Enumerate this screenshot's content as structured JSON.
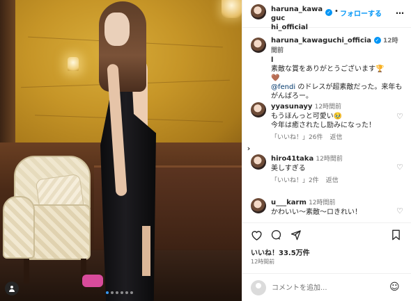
{
  "post": {
    "username": "haruna_kawaguchi_official",
    "username_line1": "haruna_kawaguc",
    "username_line2": "hi_official",
    "separator": "•",
    "follow_label": "フォローする",
    "more": "…",
    "caption": {
      "username_line1": "haruna_kawaguchi_officia",
      "username_line2": "l",
      "time": "12時間前",
      "line1": "素敵な賞をありがとうございます🏆",
      "line2": "🤎",
      "mention": "@fendi",
      "line3_rest": " のドレスが超素敵だった。来年もがんばろー。"
    },
    "likes": "いいね！33.5万件",
    "timestamp": "12時間前"
  },
  "comments": [
    {
      "username": "yyasunayy",
      "time": "12時間前",
      "text_line1": "もうほんっと可愛い🥹",
      "text_line2": "今年は癒されたし励みになった！",
      "like_label": "「いいね！」26件",
      "reply_label": "返信"
    },
    {
      "username": "hiro41taka",
      "time": "12時間前",
      "text_line1": "美しすぎる",
      "like_label": "「いいね！」2件",
      "reply_label": "返信"
    },
    {
      "username": "u___karm",
      "time": "12時間前",
      "text_line1": "かわいい〜素敵〜ロきれい！"
    }
  ],
  "composer": {
    "placeholder": "コメントを追加..."
  },
  "icons": {
    "heart": "heart-icon",
    "comment": "comment-icon",
    "share": "share-icon",
    "save": "bookmark-icon",
    "emoji": "emoji-icon",
    "next": "chevron-right-icon",
    "tag": "user-tag-icon"
  },
  "carousel": {
    "slides": 6,
    "active": 0
  },
  "colors": {
    "accent": "#0095f6",
    "link": "#00376b",
    "muted": "#737373"
  }
}
